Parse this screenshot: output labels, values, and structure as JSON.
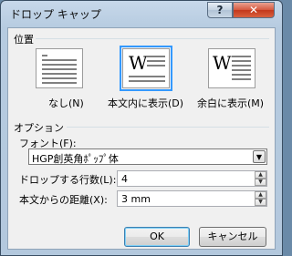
{
  "window": {
    "title": "ドロップ キャップ",
    "help_label": "?",
    "close_label": "✕"
  },
  "position": {
    "section_label": "位置",
    "options": [
      {
        "label": "なし(N)",
        "selected": false
      },
      {
        "label": "本文内に表示(D)",
        "selected": true
      },
      {
        "label": "余白に表示(M)",
        "selected": false
      }
    ],
    "w_glyph": "W"
  },
  "options": {
    "section_label": "オプション",
    "font_label": "フォント(F):",
    "font_value": "HGP創英角ﾎﾟｯﾌﾟ体",
    "lines_label": "ドロップする行数(L):",
    "lines_value": "4",
    "distance_label": "本文からの距離(X):",
    "distance_value": "3 mm"
  },
  "buttons": {
    "ok": "OK",
    "cancel": "キャンセル"
  }
}
